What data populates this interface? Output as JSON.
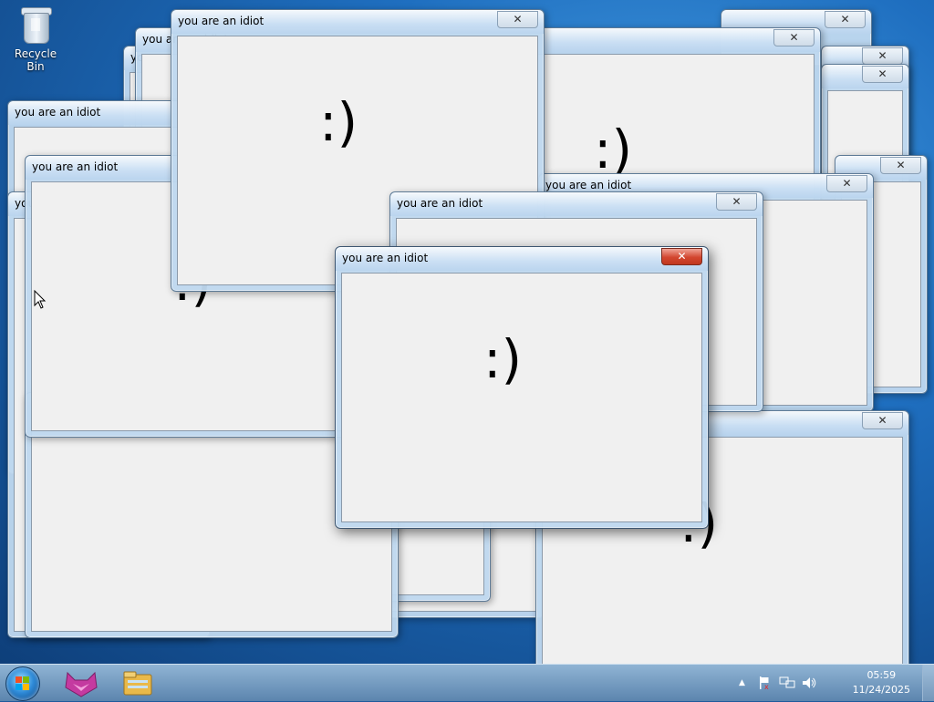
{
  "desktop": {
    "icons": [
      {
        "label": "Recycle Bin",
        "icon": "recycle-bin-icon"
      }
    ]
  },
  "popup": {
    "title": "you are an idiot",
    "face": ":)",
    "close_glyph": "✕"
  },
  "taskbar": {
    "start_icon": "windows-start-orb-icon",
    "pinned": [
      {
        "icon": "fox-app-icon"
      },
      {
        "icon": "file-explorer-icon"
      }
    ],
    "tray": {
      "overflow_glyph": "▲",
      "icons": [
        "action-center-flag-icon",
        "network-icon",
        "volume-icon"
      ],
      "time": "05:59",
      "date": "11/24/2025"
    }
  },
  "colors": {
    "close_active": "#d2462f",
    "titlebar": "#cfe0f2",
    "client": "#f0f0f0"
  }
}
